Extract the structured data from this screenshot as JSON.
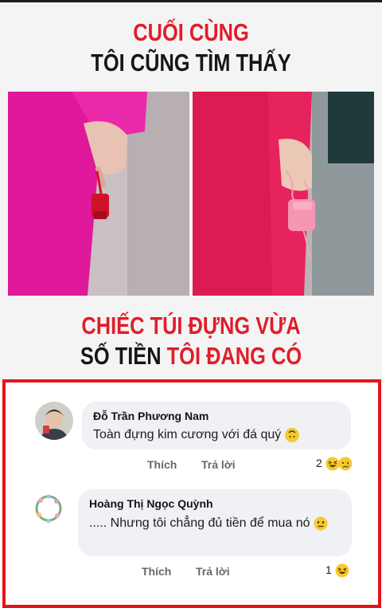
{
  "meme": {
    "line1": "CUỐI CÙNG",
    "line2": "TÔI CŨNG TÌM THẤY",
    "line3": "CHIẾC TÚI ĐỰNG VỪA",
    "line4_a": "SỐ TIỀN ",
    "line4_b": "TÔI ĐANG CÓ"
  },
  "comments": [
    {
      "author": "Đỗ Trần Phương Nam",
      "text": "Toàn đựng kim cương với đá quý",
      "like_label": "Thích",
      "reply_label": "Trả lời",
      "reaction_count": "2",
      "reactions": [
        "laughing-emoji",
        "sad-emoji"
      ]
    },
    {
      "author": "Hoàng Thị Ngọc Quỳnh",
      "text": "..... Nhưng tôi chẳng đủ tiền để mua nó",
      "like_label": "Thích",
      "reply_label": "Trả lời",
      "reaction_count": "1",
      "reactions": [
        "laughing-emoji"
      ]
    }
  ],
  "colors": {
    "highlight_border": "#e3151b",
    "headline_red": "#e11d2a",
    "bubble_bg": "#eff1f4"
  }
}
